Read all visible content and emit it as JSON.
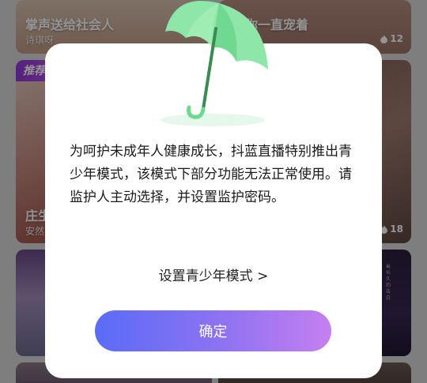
{
  "rooms": [
    {
      "title": "掌声送给社会人",
      "host": "诗琪呀",
      "count": ""
    },
    {
      "title": "你一直宠着",
      "host": "",
      "count": "12"
    },
    {
      "badge": "推荐",
      "title": "庄生",
      "host": "安然",
      "count": ""
    },
    {
      "title": "",
      "host": "",
      "count": "18"
    },
    {
      "title": "",
      "host": "",
      "count": ""
    },
    {
      "title": "",
      "host": "",
      "count": "",
      "side_text": "最长久的告白"
    },
    {
      "title": "",
      "host": "",
      "count": ""
    },
    {
      "title": "",
      "host": "",
      "count": ""
    }
  ],
  "dialog": {
    "message": "为呵护未成年人健康成长，抖蓝直播特别推出青少年模式，该模式下部分功能无法正常使用。请监护人主动选择，并设置监护密码。",
    "set_mode_link": "设置青少年模式 >",
    "confirm_label": "确定"
  },
  "colors": {
    "umbrella": "#8ee6a8",
    "umbrella_shade": "#5fcf86",
    "handle": "#3a8a52",
    "button_start": "#5a6cf6",
    "button_end": "#c57ff0"
  },
  "icons": {
    "viewer_count": "flame-icon",
    "hero": "umbrella-icon"
  }
}
